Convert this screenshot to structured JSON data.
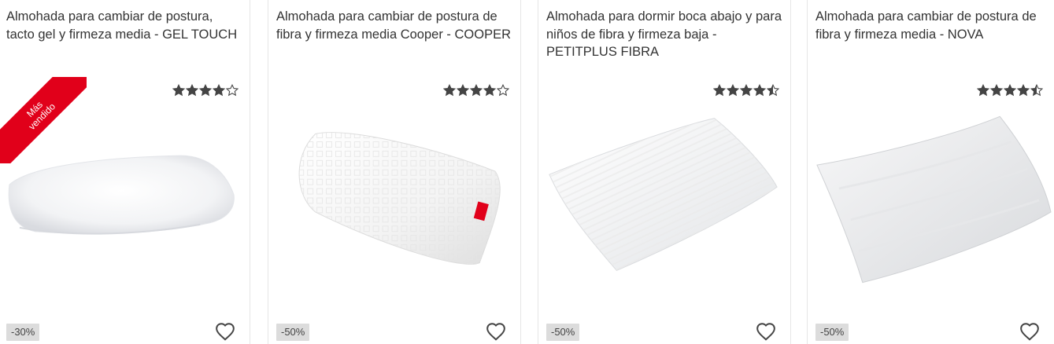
{
  "products": [
    {
      "title": "Almohada para cambiar de postura, tacto gel y firmeza media - GEL TOUCH",
      "rating": 4,
      "badge": "Más vendido",
      "discount": "-30%",
      "icon_wishlist": "heart-outline-icon"
    },
    {
      "title": "Almohada para cambiar de postura de fibra y firmeza media Cooper - COOPER",
      "rating": 4,
      "discount": "-50%",
      "icon_wishlist": "heart-outline-icon"
    },
    {
      "title": "Almohada para dormir boca abajo y para niños de fibra y firmeza baja - PETITPLUS FIBRA",
      "rating": 4.5,
      "discount": "-50%",
      "icon_wishlist": "heart-outline-icon"
    },
    {
      "title": "Almohada para cambiar de postura de fibra y firmeza media - NOVA",
      "rating": 4.5,
      "discount": "-50%",
      "icon_wishlist": "heart-outline-icon"
    }
  ],
  "colors": {
    "badge": "#e1001a",
    "star": "#444444",
    "discount_bg": "#dcdcdc"
  }
}
